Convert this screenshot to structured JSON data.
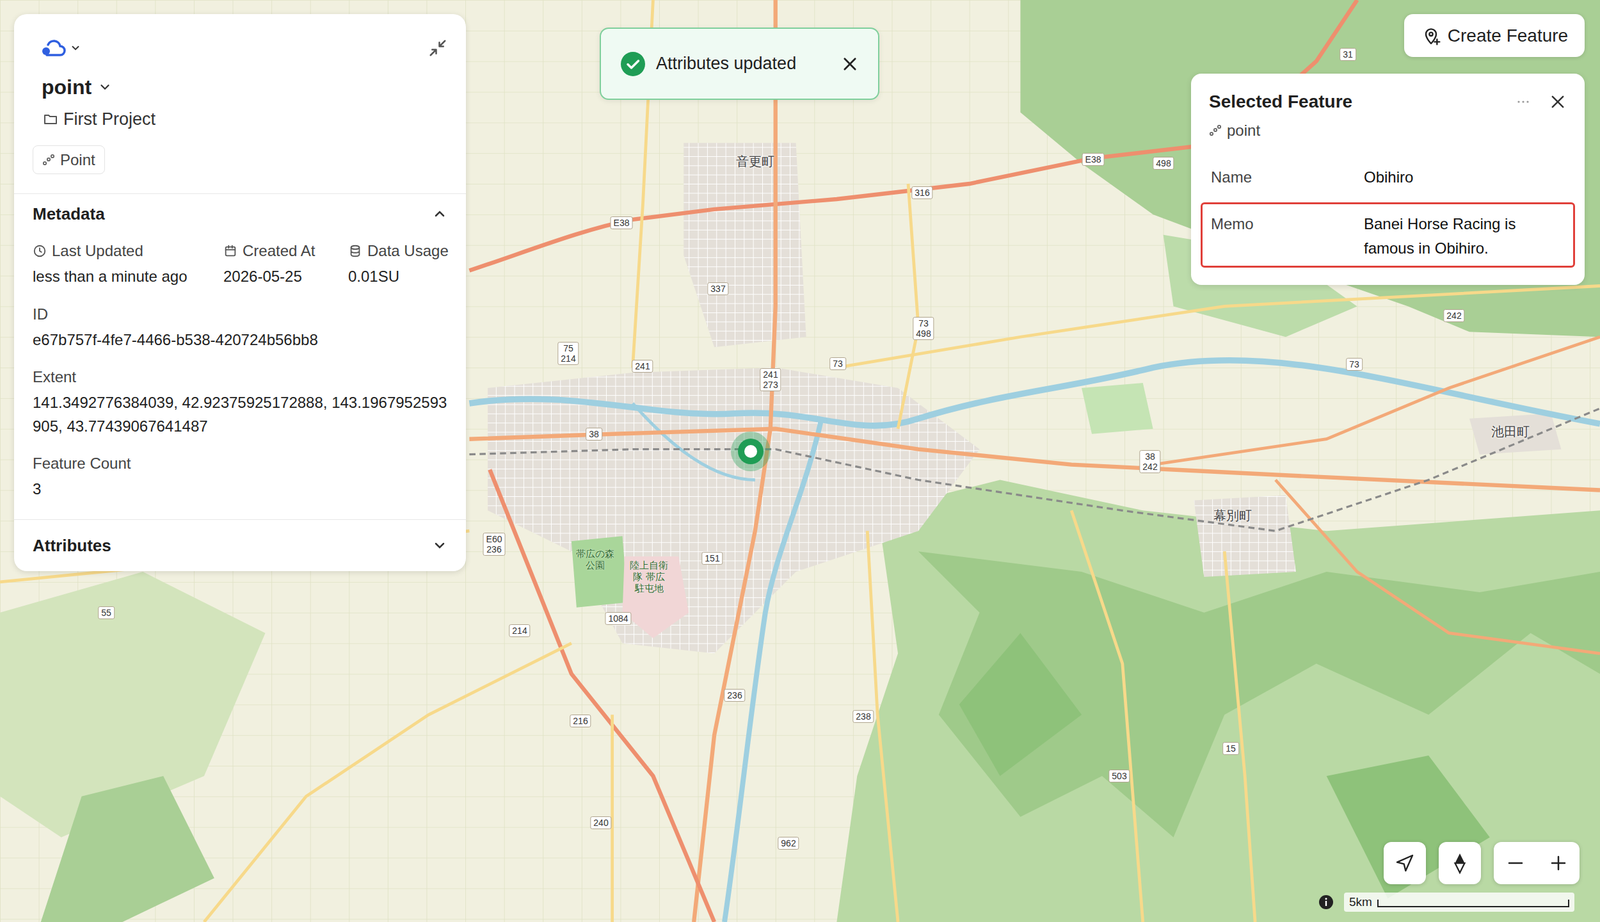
{
  "layer_panel": {
    "title": "point",
    "project": "First Project",
    "geometry_badge": "Point",
    "metadata": {
      "heading": "Metadata",
      "expanded": true,
      "summary": [
        {
          "label": "Last Updated",
          "value": "less than a minute ago"
        },
        {
          "label": "Created At",
          "value": "2026-05-25"
        },
        {
          "label": "Data Usage",
          "value": "0.01SU"
        }
      ],
      "details": [
        {
          "label": "ID",
          "value": "e67b757f-4fe7-4466-b538-420724b56bb8"
        },
        {
          "label": "Extent",
          "value": "141.3492776384039, 42.92375925172888, 143.1967952593905, 43.77439067641487"
        },
        {
          "label": "Feature Count",
          "value": "3"
        }
      ]
    },
    "attributes": {
      "heading": "Attributes",
      "expanded": false
    }
  },
  "toast": {
    "message": "Attributes updated"
  },
  "create_feature_button": "Create Feature",
  "selected_feature": {
    "title": "Selected Feature",
    "layer": "point",
    "fields": [
      {
        "label": "Name",
        "value": "Obihiro",
        "highlighted": false
      },
      {
        "label": "Memo",
        "value": "Banei Horse Racing is famous in Obihiro.",
        "highlighted": true
      }
    ]
  },
  "map": {
    "pins": [
      {
        "selected": true
      }
    ],
    "scale": "5km",
    "labels": [
      {
        "text": "音更町",
        "kind": "place"
      },
      {
        "text": "幕別町",
        "kind": "place"
      },
      {
        "text": "池田町",
        "kind": "place"
      },
      {
        "text": "帯広の森\n公園",
        "kind": "area"
      },
      {
        "text": "陸上自衛\n隊 帯広\n駐屯地",
        "kind": "area"
      },
      {
        "text": "E38",
        "kind": "shield"
      },
      {
        "text": "E38",
        "kind": "shield"
      },
      {
        "text": "316",
        "kind": "shield"
      },
      {
        "text": "498",
        "kind": "shield"
      },
      {
        "text": "31",
        "kind": "shield"
      },
      {
        "text": "337",
        "kind": "shield"
      },
      {
        "text": "241",
        "kind": "shield"
      },
      {
        "text": "241\n273",
        "kind": "shield"
      },
      {
        "text": "73",
        "kind": "shield"
      },
      {
        "text": "73\n498",
        "kind": "shield"
      },
      {
        "text": "75\n214",
        "kind": "shield"
      },
      {
        "text": "38",
        "kind": "shield"
      },
      {
        "text": "38\n242",
        "kind": "shield"
      },
      {
        "text": "242",
        "kind": "shield"
      },
      {
        "text": "73",
        "kind": "shield"
      },
      {
        "text": "E60\n236",
        "kind": "shield"
      },
      {
        "text": "151",
        "kind": "shield"
      },
      {
        "text": "1084",
        "kind": "shield"
      },
      {
        "text": "214",
        "kind": "shield"
      },
      {
        "text": "236",
        "kind": "shield"
      },
      {
        "text": "216",
        "kind": "shield"
      },
      {
        "text": "238",
        "kind": "shield"
      },
      {
        "text": "240",
        "kind": "shield"
      },
      {
        "text": "962",
        "kind": "shield"
      },
      {
        "text": "55",
        "kind": "shield"
      },
      {
        "text": "503",
        "kind": "shield"
      },
      {
        "text": "15",
        "kind": "shield"
      }
    ]
  }
}
